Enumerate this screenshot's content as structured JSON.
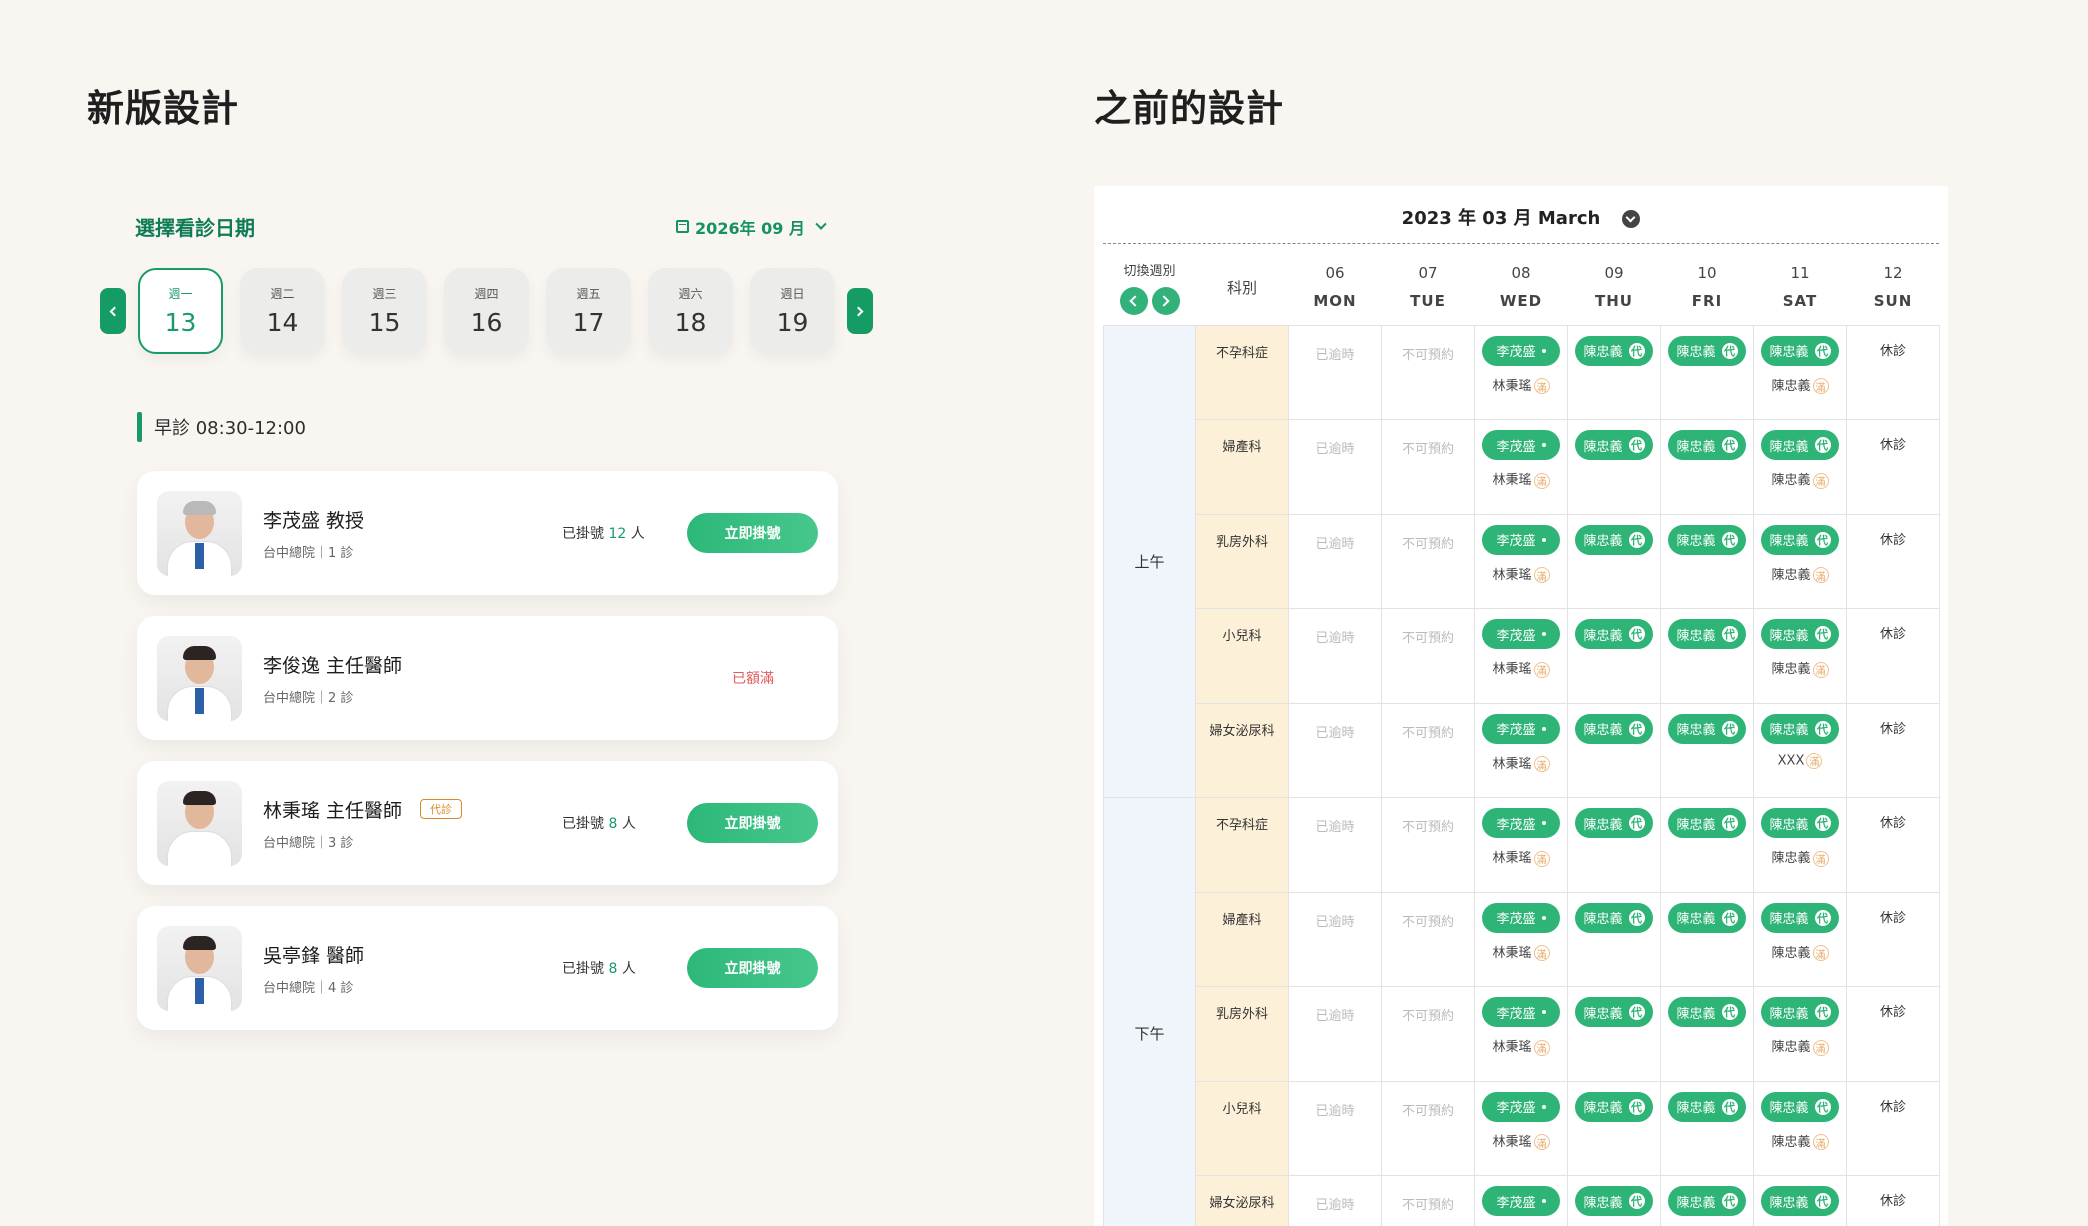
{
  "titles": {
    "new": "新版設計",
    "old": "之前的設計"
  },
  "new_design": {
    "date_label": "選擇看診日期",
    "month": "2026年 09 月",
    "days": [
      {
        "weekday": "週一",
        "date": "13",
        "active": true
      },
      {
        "weekday": "週二",
        "date": "14"
      },
      {
        "weekday": "週三",
        "date": "15"
      },
      {
        "weekday": "週四",
        "date": "16"
      },
      {
        "weekday": "週五",
        "date": "17"
      },
      {
        "weekday": "週六",
        "date": "18"
      },
      {
        "weekday": "週日",
        "date": "19"
      }
    ],
    "session": "早診 08:30-12:00",
    "doctors": [
      {
        "name": "李茂盛 教授",
        "location": "台中總院｜1 診",
        "count_prefix": "已掛號",
        "count": "12",
        "count_unit": "人",
        "button": "立即掛號"
      },
      {
        "name": "李俊逸 主任醫師",
        "location": "台中總院｜2 診",
        "status": "已額滿"
      },
      {
        "name": "林秉瑤 主任醫師",
        "badge": "代診",
        "location": "台中總院｜3 診",
        "count_prefix": "已掛號",
        "count": "8",
        "count_unit": "人",
        "button": "立即掛號"
      },
      {
        "name": "吳亭鋒 醫師",
        "location": "台中總院｜4 診",
        "count_prefix": "已掛號",
        "count": "8",
        "count_unit": "人",
        "button": "立即掛號"
      }
    ]
  },
  "old_design": {
    "month": "2023 年 03 月 March",
    "switch_label": "切換週別",
    "dept_header": "科別",
    "columns": [
      {
        "num": "06",
        "dow": "MON"
      },
      {
        "num": "07",
        "dow": "TUE"
      },
      {
        "num": "08",
        "dow": "WED"
      },
      {
        "num": "09",
        "dow": "THU"
      },
      {
        "num": "10",
        "dow": "FRI"
      },
      {
        "num": "11",
        "dow": "SAT"
      },
      {
        "num": "12",
        "dow": "SUN"
      }
    ],
    "periods": [
      "上午",
      "下午"
    ],
    "past_text": "已逾時",
    "unavailable_text": "不可預約",
    "closed_text": "休診",
    "wed_doctor": "李茂盛",
    "sub_doctor": "林秉瑤",
    "sub_mark": "滿",
    "substitute_doctor": "陳忠義",
    "dai_mark": "代",
    "rows": [
      {
        "dept": "不孕科症",
        "sat_sub": "陳忠義"
      },
      {
        "dept": "婦產科",
        "sat_sub": "陳忠義"
      },
      {
        "dept": "乳房外科",
        "sat_sub": "陳忠義"
      },
      {
        "dept": "小兒科",
        "sat_sub": "陳忠義"
      },
      {
        "dept": "婦女泌尿科",
        "sat_sub": "XXX"
      },
      {
        "dept": "不孕科症",
        "sat_sub": "陳忠義"
      },
      {
        "dept": "婦產科",
        "sat_sub": "陳忠義"
      },
      {
        "dept": "乳房外科",
        "sat_sub": "陳忠義"
      },
      {
        "dept": "小兒科",
        "sat_sub": "陳忠義"
      },
      {
        "dept": "婦女泌尿科",
        "sat_sub": ""
      }
    ]
  }
}
